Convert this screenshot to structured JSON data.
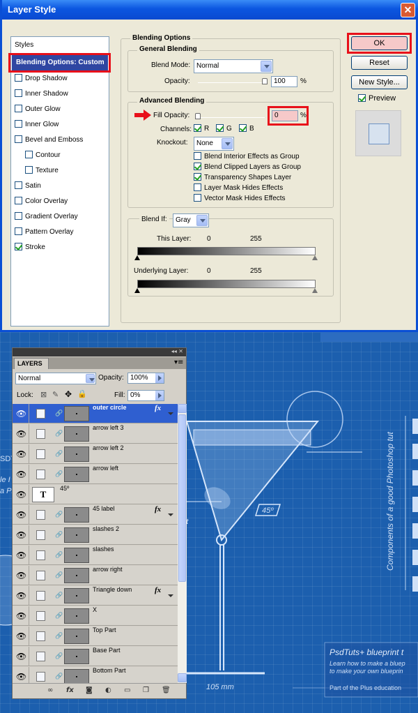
{
  "dialog": {
    "title": "Layer Style",
    "close_glyph": "✕",
    "styles_header": "Styles",
    "selected_style": "Blending Options: Custom",
    "styles": [
      {
        "label": "Drop Shadow",
        "checked": false
      },
      {
        "label": "Inner Shadow",
        "checked": false
      },
      {
        "label": "Outer Glow",
        "checked": false
      },
      {
        "label": "Inner Glow",
        "checked": false
      },
      {
        "label": "Bevel and Emboss",
        "checked": false
      },
      {
        "label": "Contour",
        "checked": false
      },
      {
        "label": "Texture",
        "checked": false
      },
      {
        "label": "Satin",
        "checked": false
      },
      {
        "label": "Color Overlay",
        "checked": false
      },
      {
        "label": "Gradient Overlay",
        "checked": false
      },
      {
        "label": "Pattern Overlay",
        "checked": false
      },
      {
        "label": "Stroke",
        "checked": true
      }
    ],
    "blending_options": "Blending Options",
    "general_blending": "General Blending",
    "blend_mode_label": "Blend Mode:",
    "blend_mode_value": "Normal",
    "opacity_label": "Opacity:",
    "opacity_value": "100",
    "percent": "%",
    "advanced_blending": "Advanced Blending",
    "fill_opacity_label": "Fill Opacity:",
    "fill_opacity_value": "0",
    "channels_label": "Channels:",
    "channel_r": "R",
    "channel_g": "G",
    "channel_b": "B",
    "knockout_label": "Knockout:",
    "knockout_value": "None",
    "options": [
      {
        "label": "Blend Interior Effects as Group",
        "checked": false
      },
      {
        "label": "Blend Clipped Layers as Group",
        "checked": true
      },
      {
        "label": "Transparency Shapes Layer",
        "checked": true
      },
      {
        "label": "Layer Mask Hides Effects",
        "checked": false
      },
      {
        "label": "Vector Mask Hides Effects",
        "checked": false
      }
    ],
    "blend_if_label": "Blend If:",
    "blend_if_value": "Gray",
    "this_layer_label": "This Layer:",
    "this_layer_min": "0",
    "this_layer_max": "255",
    "underlying_layer_label": "Underlying Layer:",
    "underlying_min": "0",
    "underlying_max": "255",
    "ok_label": "OK",
    "reset_label": "Reset",
    "new_style_label": "New Style...",
    "preview_label": "Preview",
    "preview_checked": true
  },
  "blueprint": {
    "measure_45": "45º",
    "side_text": "Components of a good Photoshop tut",
    "measure_105": "105 mm",
    "banner_title": "PsdTuts+ blueprint t",
    "banner_line1": "Learn how to make a bluep",
    "banner_line2": "to make your own blueprin",
    "banner_footer": "Part of the Plus education",
    "left_text": "SDT",
    "left_text2": "le I",
    "left_text3": "a Ph",
    "ment_text": "ent"
  },
  "layers": {
    "tab": "LAYERS",
    "collapse_glyph": "◂◂ ✕",
    "blend_mode": "Normal",
    "opacity_label": "Opacity:",
    "opacity_value": "100%",
    "lock_label": "Lock:",
    "fill_label": "Fill:",
    "fill_value": "0%",
    "rows": [
      {
        "name": "outer circle",
        "fx": true,
        "selected": true
      },
      {
        "name": "arrow left 3",
        "fx": false
      },
      {
        "name": "arrow left 2",
        "fx": false
      },
      {
        "name": "arrow left",
        "fx": false
      },
      {
        "name": "45º",
        "fx": false,
        "text_layer": true
      },
      {
        "name": "45 label",
        "fx": true
      },
      {
        "name": "slashes 2",
        "fx": false
      },
      {
        "name": "slashes",
        "fx": false
      },
      {
        "name": "arrow right",
        "fx": false
      },
      {
        "name": "Triangle down",
        "fx": true
      },
      {
        "name": "X",
        "fx": false
      },
      {
        "name": "Top Part",
        "fx": false
      },
      {
        "name": "Base Part",
        "fx": false
      },
      {
        "name": "Bottom Part",
        "fx": false
      }
    ],
    "fx_glyph": "fx",
    "eye_glyph": "👁",
    "text_glyph": "T"
  }
}
